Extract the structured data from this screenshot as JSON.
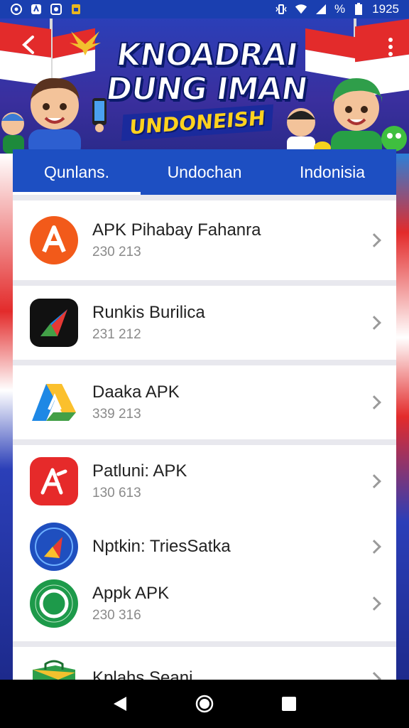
{
  "status_bar": {
    "time": "1925",
    "battery_text": "%",
    "left_icons": [
      "vpn-icon",
      "sync-icon",
      "record-icon",
      "sim-icon"
    ],
    "right_icons": [
      "vibrate-icon",
      "wifi-icon",
      "signal-icon",
      "battery-icon"
    ]
  },
  "banner": {
    "line1": "KNOADRAI",
    "line2": "DUNG IMAN",
    "line3": "UNDONEISH",
    "back_icon": "back-arrow-icon",
    "more_icon": "more-vert-icon"
  },
  "tabs": [
    {
      "label": "Qunlans.",
      "active": true
    },
    {
      "label": "Undochan",
      "active": false
    },
    {
      "label": "Indonisia",
      "active": false
    }
  ],
  "apps": [
    {
      "name": "APK Pihabay Fahanra",
      "meta": "230 213",
      "icon": "apk-red-a-icon"
    },
    {
      "name": "Runkis Burilica",
      "meta": "231 212",
      "icon": "arrow-play-icon"
    },
    {
      "name": "Daaka APK",
      "meta": "339 213",
      "icon": "drive-triangle-icon"
    },
    {
      "name": "Patluni: APK",
      "meta": "130 613",
      "icon": "red-a-icon"
    },
    {
      "name": "Nptkin: TriesSatka",
      "meta": "",
      "icon": "play-compass-icon"
    },
    {
      "name": "Appk APK",
      "meta": "230 316",
      "icon": "green-badge-icon"
    },
    {
      "name": "Kplahs Seani",
      "meta": "",
      "icon": "green-bag-icon"
    }
  ],
  "colors": {
    "accent": "#1d4fc2",
    "status_bar": "#1a3fb0",
    "nav_bar": "#000000"
  },
  "nav": [
    "back-nav-icon",
    "home-nav-icon",
    "recents-nav-icon"
  ]
}
